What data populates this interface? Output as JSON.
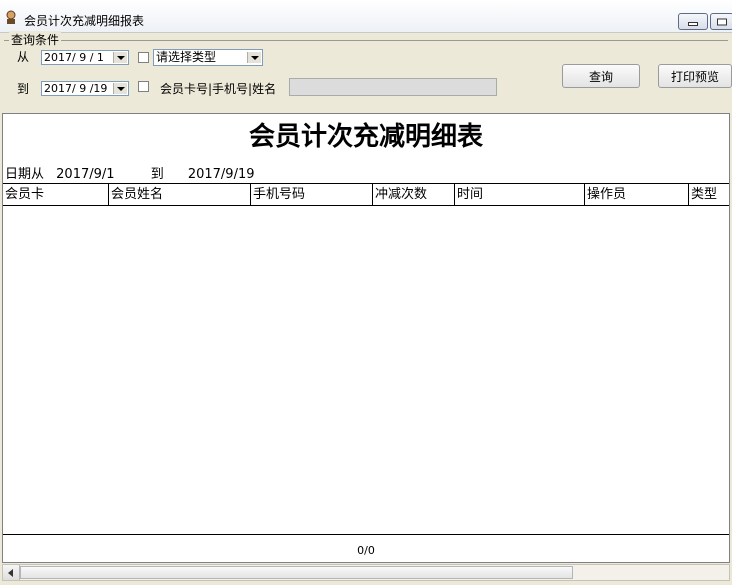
{
  "window": {
    "title": "会员计次充减明细报表"
  },
  "query": {
    "group_label": "查询条件",
    "from_label": "从",
    "to_label": "到",
    "from_date": "2017/ 9 / 1",
    "to_date": "2017/ 9 /19",
    "type_placeholder": "请选择类型",
    "member_label": "会员卡号|手机号|姓名",
    "member_value": "",
    "type_checked": false,
    "member_checked": false,
    "query_button": "查询",
    "print_button": "打印预览"
  },
  "report": {
    "title": "会员计次充减明细表",
    "date_from_label": "日期从",
    "date_from": "2017/9/1",
    "date_to_label": "到",
    "date_to": "2017/9/19",
    "columns": [
      "会员卡",
      "会员姓名",
      "手机号码",
      "冲减次数",
      "时间",
      "操作员",
      "类型"
    ],
    "rows": [],
    "page_count": "0/0"
  }
}
